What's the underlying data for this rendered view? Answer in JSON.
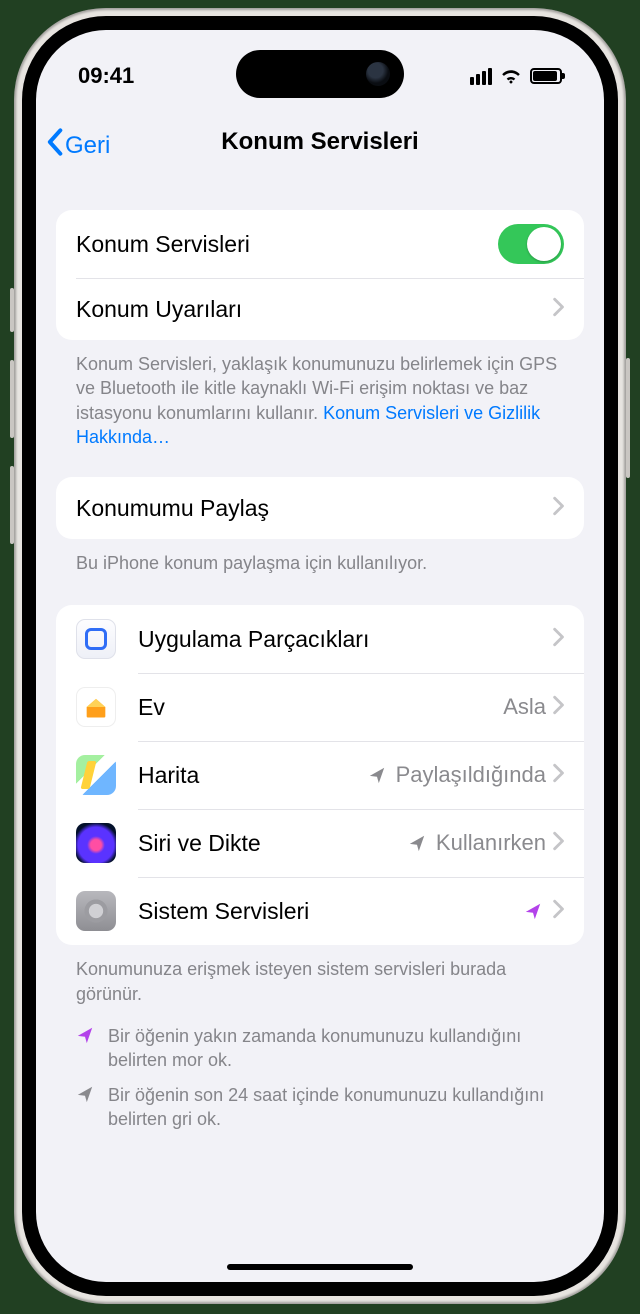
{
  "status": {
    "time": "09:41"
  },
  "nav": {
    "back": "Geri",
    "title": "Konum Servisleri"
  },
  "main_toggle": {
    "label": "Konum Servisleri",
    "on": true
  },
  "alerts_row": {
    "label": "Konum Uyarıları"
  },
  "description": {
    "text": "Konum Servisleri, yaklaşık konumunuzu belirlemek için GPS ve Bluetooth ile kitle kaynaklı Wi-Fi erişim noktası ve baz istasyonu konumlarını kullanır. ",
    "link": "Konum Servisleri ve Gizlilik Hakkında…"
  },
  "share": {
    "label": "Konumumu Paylaş",
    "footer": "Bu iPhone konum paylaşma için kullanılıyor."
  },
  "apps": [
    {
      "name": "Uygulama Parçacıkları",
      "detail": "",
      "indicator": "none",
      "icon": "widgets"
    },
    {
      "name": "Ev",
      "detail": "Asla",
      "indicator": "none",
      "icon": "home"
    },
    {
      "name": "Harita",
      "detail": "Paylaşıldığında",
      "indicator": "gray",
      "icon": "maps"
    },
    {
      "name": "Siri ve Dikte",
      "detail": "Kullanırken",
      "indicator": "gray",
      "icon": "siri"
    },
    {
      "name": "Sistem Servisleri",
      "detail": "",
      "indicator": "purple",
      "icon": "settings"
    }
  ],
  "apps_footer": "Konumunuza erişmek isteyen sistem servisleri burada görünür.",
  "legend": {
    "purple": "Bir öğenin yakın zamanda konumunuzu kullandığını belirten mor ok.",
    "gray": "Bir öğenin son 24 saat içinde konumunuzu kullandığını belirten gri ok."
  }
}
